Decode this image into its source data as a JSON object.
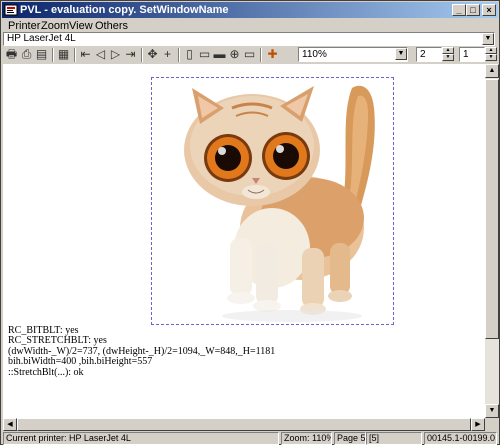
{
  "window": {
    "title": "PVL - evaluation copy. SetWindowName"
  },
  "titlebar_buttons": {
    "minimize": "_",
    "maximize": "□",
    "close": "×"
  },
  "menu": [
    "Printer",
    "Zoom",
    "View",
    "Others"
  ],
  "printer_select": {
    "value": "HP LaserJet 4L"
  },
  "toolbar": {
    "icons": [
      "printer-icon",
      "print-preview-icon",
      "page-setup-icon",
      "properties-icon",
      "page-first-icon",
      "page-prev-icon",
      "page-next-icon",
      "page-last-icon",
      "move-icon",
      "crosshair-icon",
      "fit-page-icon",
      "fit-width-icon",
      "fit-height-icon",
      "zoom-icon",
      "zoom-window-icon",
      "settings-icon"
    ],
    "zoom_value": "110%",
    "page_value": "2",
    "copies_value": "1"
  },
  "report_lines": [
    "RC_BITBLT: yes",
    "RC_STRETCHBLT: yes",
    "(dwWidth-_W)/2=737, (dwHeight-_H)/2=1094,_W=848,_H=1181",
    "bih.biWidth=400 ,bih.biHeight=557",
    "::StretchBlt(...): ok"
  ],
  "status": {
    "printer": "Current printer: HP LaserJet 4L",
    "zoom": "Zoom: 110%",
    "page": "Page 5",
    "page_count": "[5]",
    "coords": "00145.1-00199.0"
  }
}
